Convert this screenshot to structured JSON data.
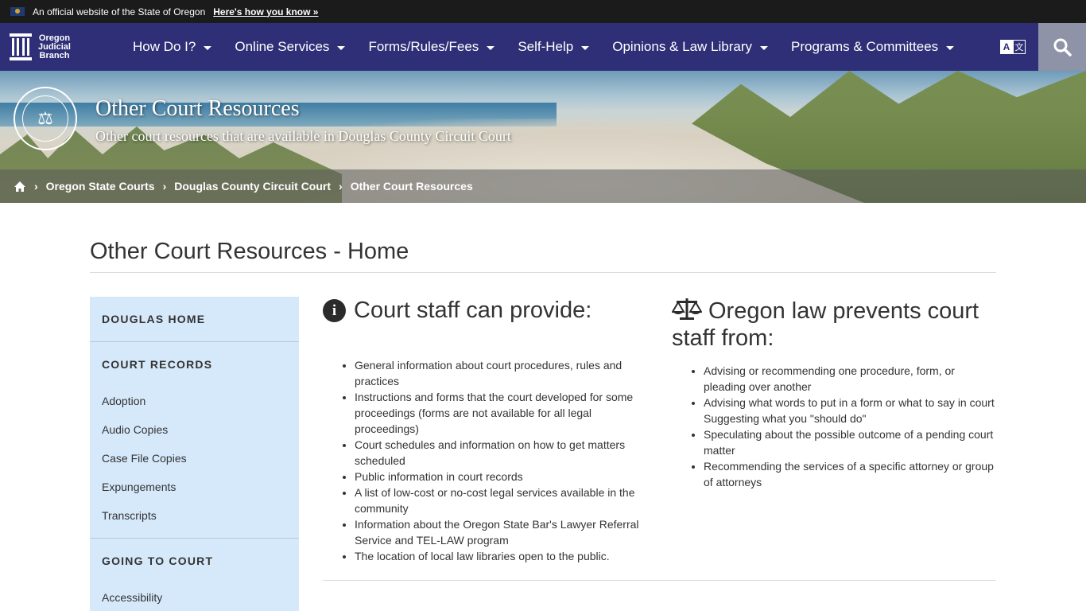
{
  "official_bar": {
    "text": "An official website of the State of Oregon",
    "link": "Here's how you know »"
  },
  "nav": {
    "logo_lines": [
      "Oregon",
      "Judicial",
      "Branch"
    ],
    "items": [
      {
        "label": "How Do I?"
      },
      {
        "label": "Online Services"
      },
      {
        "label": "Forms/Rules/Fees"
      },
      {
        "label": "Self-Help"
      },
      {
        "label": "Opinions & Law Library"
      },
      {
        "label": "Programs & Committees"
      }
    ],
    "translate_a": "A",
    "translate_b": "文",
    "search_icon": "search-icon"
  },
  "hero": {
    "title": "Other Court Resources",
    "subtitle": "Other court resources that are available in Douglas County Circuit Court",
    "breadcrumb": [
      "Oregon State Courts",
      "Douglas County Circuit Court",
      "Other Court Resources"
    ]
  },
  "page": {
    "title": "Other Court Resources - Home"
  },
  "sidebar": {
    "sections": [
      {
        "heading": "DOUGLAS HOME",
        "links": []
      },
      {
        "heading": "COURT RECORDS",
        "links": [
          "Adoption",
          "Audio Copies",
          "Case File Copies",
          "Expungements",
          "Transcripts"
        ]
      },
      {
        "heading": "GOING TO COURT",
        "links": [
          "Accessibility"
        ]
      }
    ]
  },
  "provide": {
    "title": "Court staff can provide:",
    "items": [
      "General information about court procedures, rules and practices",
      "Instructions and forms that the court developed for some proceedings (forms are not available for all legal proceedings)",
      "Court schedules and information on how to get matters scheduled",
      "Public information in court records",
      "A list of low-cost or no-cost legal services available in the community",
      "Information about the Oregon State Bar's Lawyer Referral Service and TEL-LAW program",
      "The location of local law libraries open to the public."
    ]
  },
  "prevents": {
    "title": "Oregon law prevents court staff from:",
    "items": [
      "Advising or recommending one procedure, form, or pleading over another",
      "Advising what words to put in a form or what to say in court Suggesting what you \"should do\"",
      "Speculating about the possible outcome of a pending court matter",
      "Recommending the services of a specific attorney or group of attorneys"
    ]
  }
}
